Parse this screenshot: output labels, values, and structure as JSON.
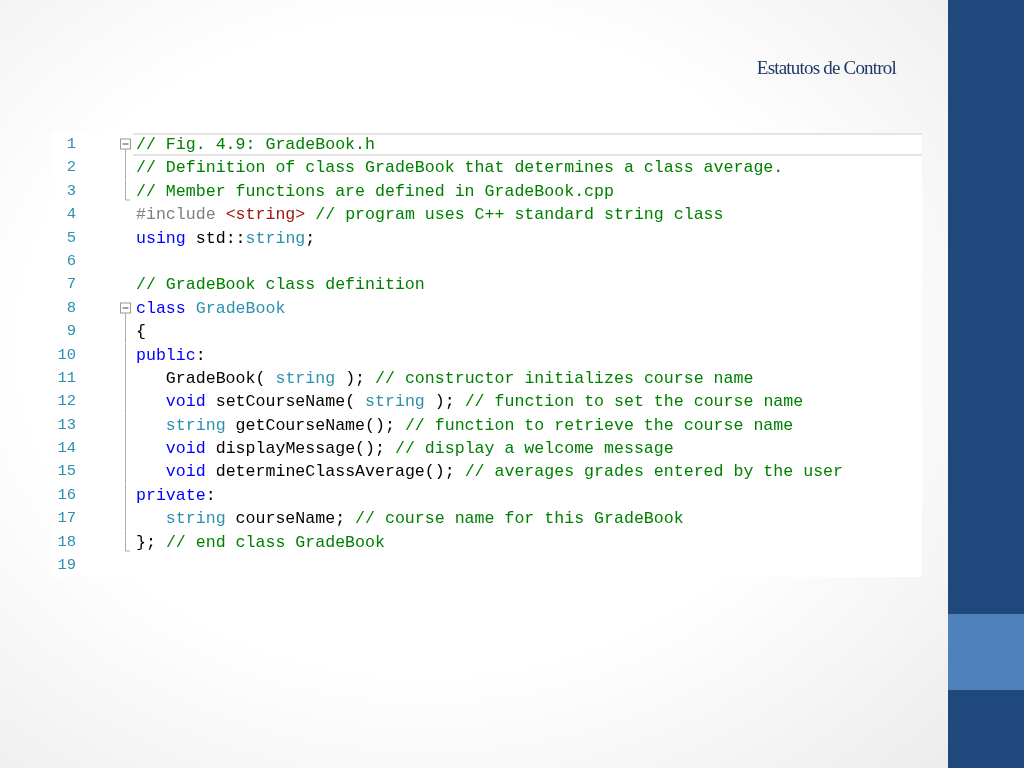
{
  "slide": {
    "title": "Estatutos de Control"
  },
  "editor": {
    "lines": [
      {
        "number": "1",
        "fold": {
          "kind": "start",
          "expanded": true
        },
        "current": true,
        "tokens": [
          {
            "kind": "comment",
            "text": "// Fig. 4.9: GradeBook.h"
          }
        ]
      },
      {
        "number": "2",
        "fold": {
          "kind": "mid"
        },
        "current": false,
        "tokens": [
          {
            "kind": "comment",
            "text": "// Definition of class GradeBook that determines a class average."
          }
        ]
      },
      {
        "number": "3",
        "fold": {
          "kind": "end"
        },
        "current": false,
        "tokens": [
          {
            "kind": "comment",
            "text": "// Member functions are defined in GradeBook.cpp"
          }
        ]
      },
      {
        "number": "4",
        "current": false,
        "tokens": [
          {
            "kind": "preproc",
            "text": "#include "
          },
          {
            "kind": "string",
            "text": "<string>"
          },
          {
            "kind": "comment",
            "text": " // program uses C++ standard string class"
          }
        ]
      },
      {
        "number": "5",
        "current": false,
        "tokens": [
          {
            "kind": "keyword",
            "text": "using"
          },
          {
            "kind": "plain",
            "text": " std::"
          },
          {
            "kind": "type",
            "text": "string"
          },
          {
            "kind": "plain",
            "text": ";"
          }
        ]
      },
      {
        "number": "6",
        "current": false
      },
      {
        "number": "7",
        "current": false,
        "tokens": [
          {
            "kind": "comment",
            "text": "// GradeBook class definition"
          }
        ]
      },
      {
        "number": "8",
        "fold": {
          "kind": "start",
          "expanded": true
        },
        "current": false,
        "tokens": [
          {
            "kind": "keyword",
            "text": "class"
          },
          {
            "kind": "type",
            "text": " GradeBook"
          }
        ]
      },
      {
        "number": "9",
        "fold": {
          "kind": "mid"
        },
        "current": false,
        "tokens": [
          {
            "kind": "plain",
            "text": "{"
          }
        ]
      },
      {
        "number": "10",
        "fold": {
          "kind": "mid"
        },
        "current": false,
        "tokens": [
          {
            "kind": "keyword",
            "text": "public"
          },
          {
            "kind": "plain",
            "text": ":"
          }
        ]
      },
      {
        "number": "11",
        "fold": {
          "kind": "mid"
        },
        "current": false,
        "tokens": [
          {
            "kind": "plain",
            "text": "   GradeBook( "
          },
          {
            "kind": "type",
            "text": "string"
          },
          {
            "kind": "plain",
            "text": " ); "
          },
          {
            "kind": "comment",
            "text": "// constructor initializes course name"
          }
        ]
      },
      {
        "number": "12",
        "fold": {
          "kind": "mid"
        },
        "current": false,
        "tokens": [
          {
            "kind": "keyword",
            "text": "   void"
          },
          {
            "kind": "plain",
            "text": " setCourseName( "
          },
          {
            "kind": "type",
            "text": "string"
          },
          {
            "kind": "plain",
            "text": " ); "
          },
          {
            "kind": "comment",
            "text": "// function to set the course name"
          }
        ]
      },
      {
        "number": "13",
        "fold": {
          "kind": "mid"
        },
        "current": false,
        "tokens": [
          {
            "kind": "type",
            "text": "   string"
          },
          {
            "kind": "plain",
            "text": " getCourseName(); "
          },
          {
            "kind": "comment",
            "text": "// function to retrieve the course name"
          }
        ]
      },
      {
        "number": "14",
        "fold": {
          "kind": "mid"
        },
        "current": false,
        "tokens": [
          {
            "kind": "keyword",
            "text": "   void"
          },
          {
            "kind": "plain",
            "text": " displayMessage(); "
          },
          {
            "kind": "comment",
            "text": "// display a welcome message"
          }
        ]
      },
      {
        "number": "15",
        "fold": {
          "kind": "mid"
        },
        "current": false,
        "tokens": [
          {
            "kind": "keyword",
            "text": "   void"
          },
          {
            "kind": "plain",
            "text": " determineClassAverage(); "
          },
          {
            "kind": "comment",
            "text": "// averages grades entered by the user"
          }
        ]
      },
      {
        "number": "16",
        "fold": {
          "kind": "mid"
        },
        "current": false,
        "tokens": [
          {
            "kind": "keyword",
            "text": "private"
          },
          {
            "kind": "plain",
            "text": ":"
          }
        ]
      },
      {
        "number": "17",
        "fold": {
          "kind": "mid"
        },
        "current": false,
        "tokens": [
          {
            "kind": "type",
            "text": "   string"
          },
          {
            "kind": "plain",
            "text": " courseName; "
          },
          {
            "kind": "comment",
            "text": "// course name for this GradeBook"
          }
        ]
      },
      {
        "number": "18",
        "fold": {
          "kind": "end"
        },
        "current": false,
        "tokens": [
          {
            "kind": "plain",
            "text": "}; "
          },
          {
            "kind": "comment",
            "text": "// end class GradeBook"
          }
        ]
      },
      {
        "number": "19",
        "current": false
      }
    ]
  }
}
